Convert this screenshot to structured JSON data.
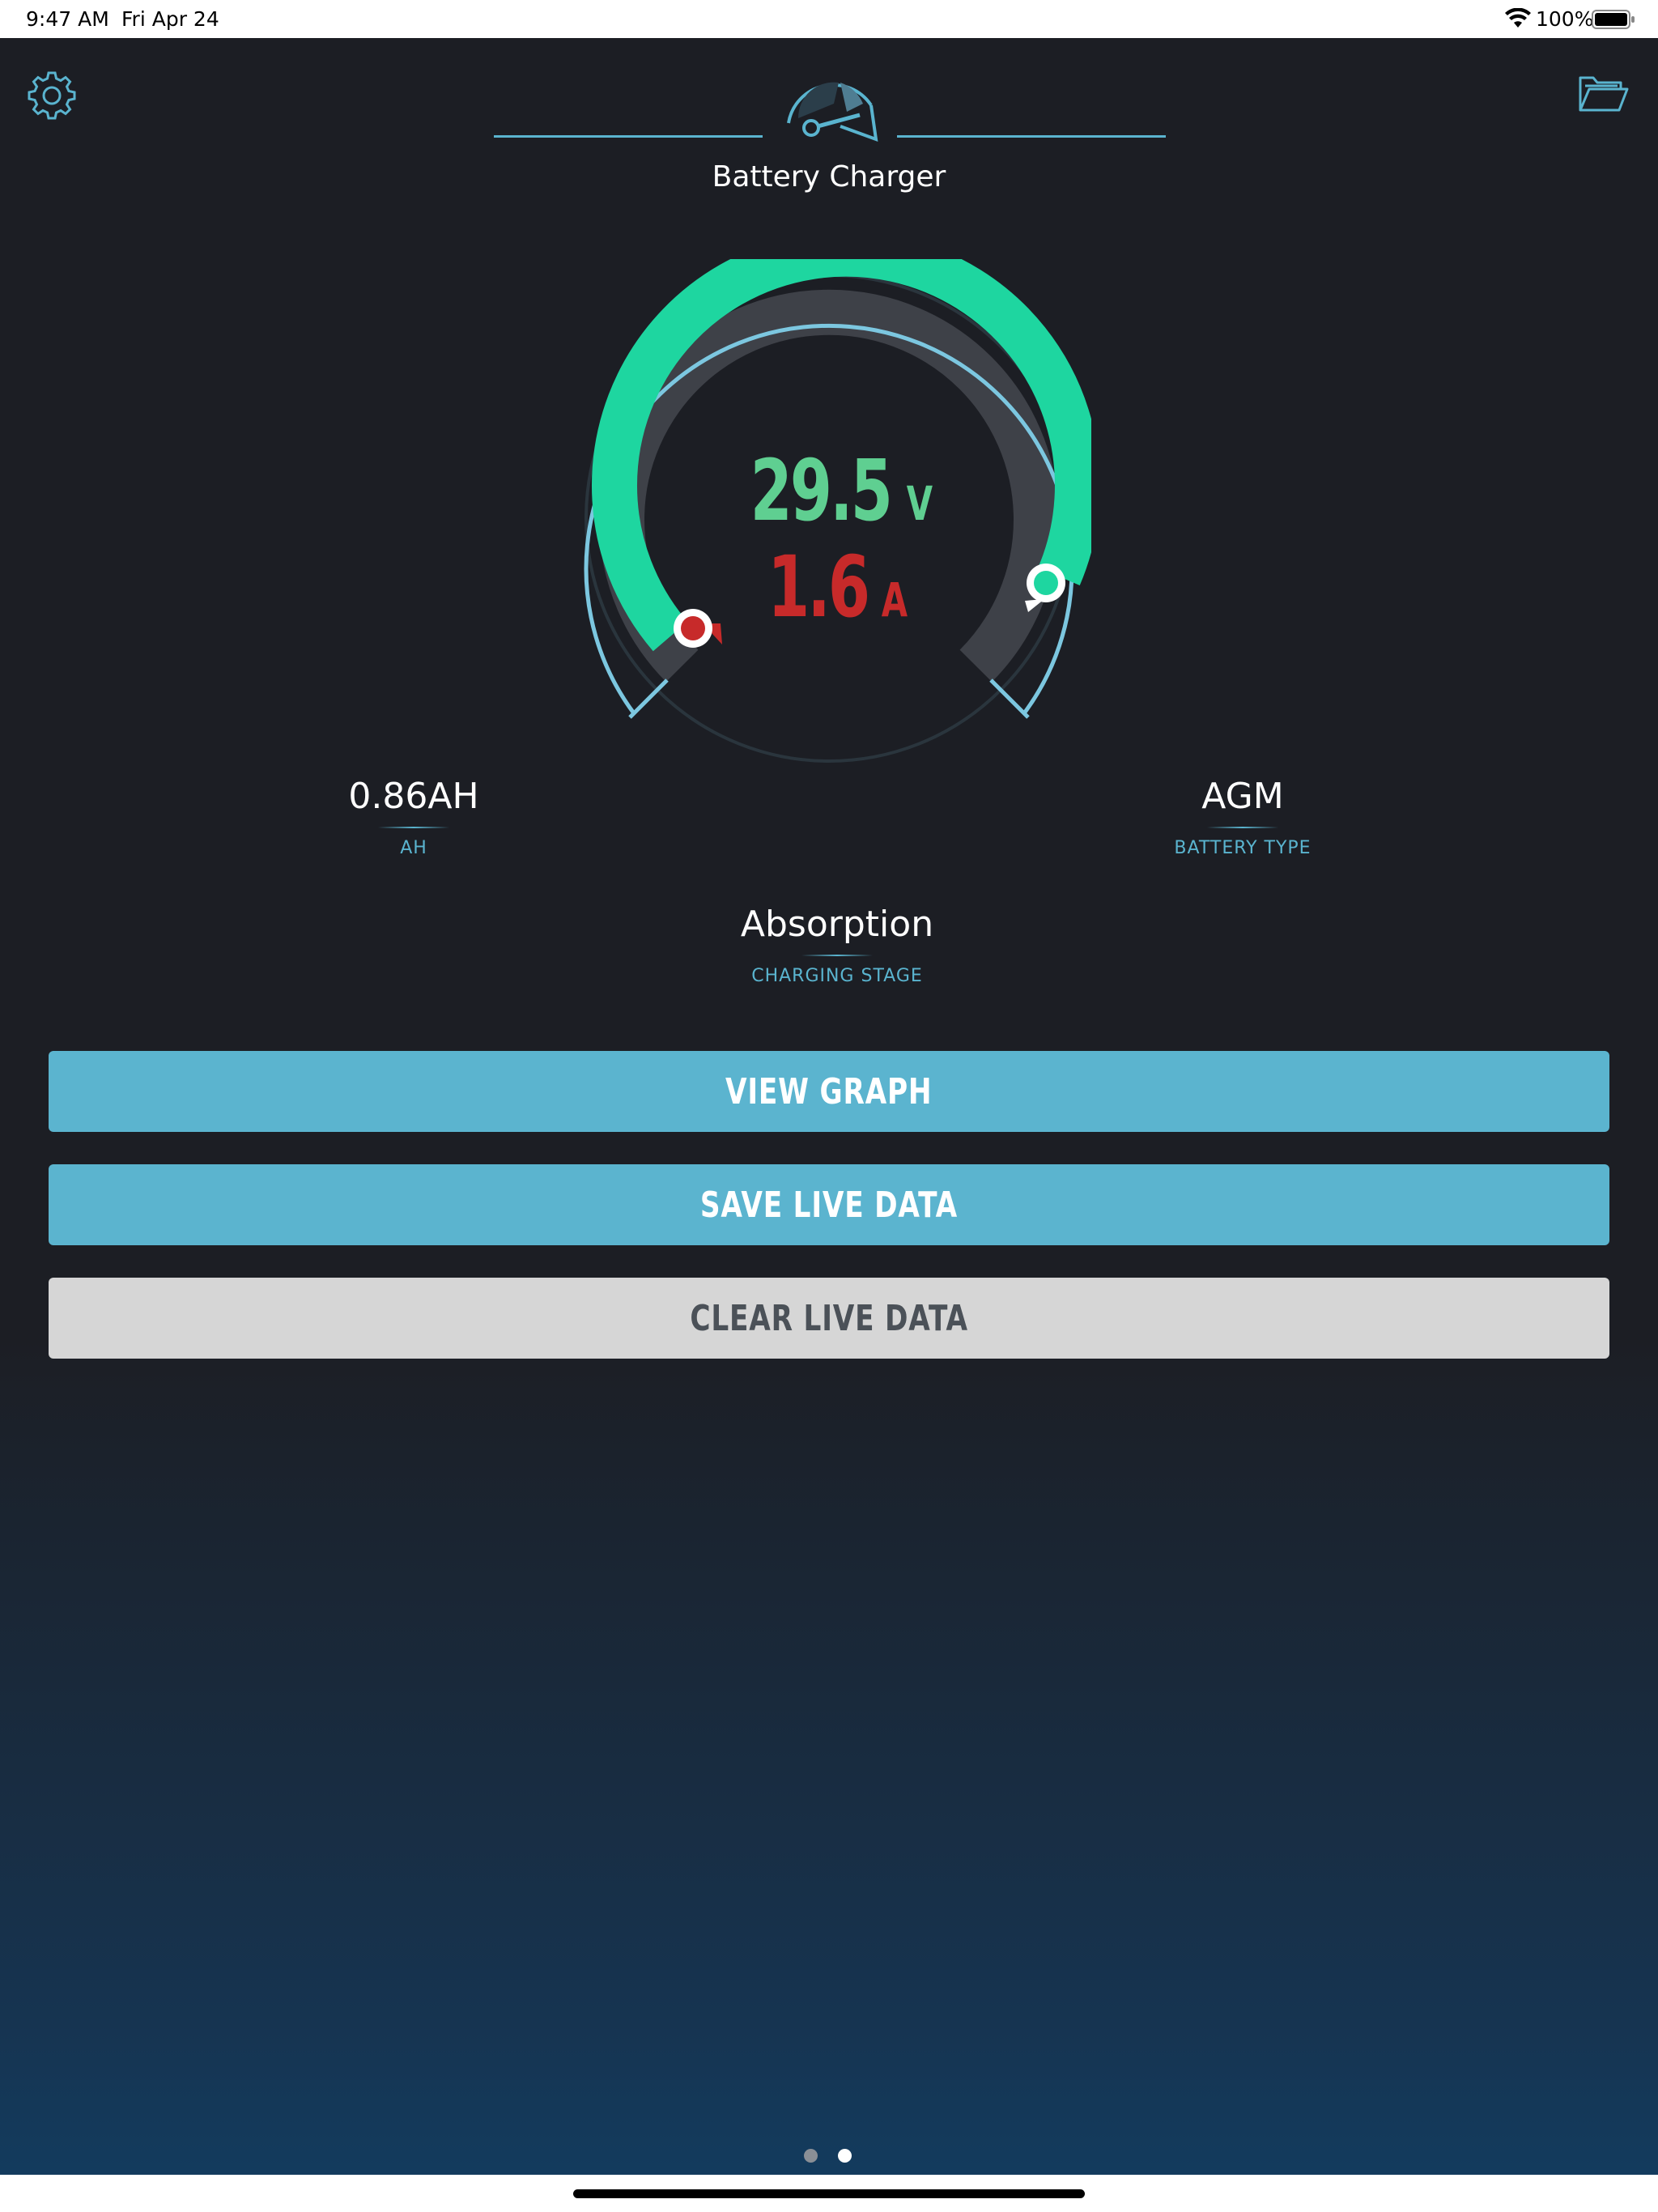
{
  "status_bar": {
    "time": "9:47 AM",
    "date": "Fri Apr 24",
    "battery_percent": "100%",
    "battery_level": 1.0
  },
  "header": {
    "title": "Battery Charger",
    "left_icon": "gear-icon",
    "center_icon": "speedometer-icon",
    "right_icon": "folder-icon"
  },
  "gauge": {
    "voltage_value": "29.5",
    "voltage_unit": "V",
    "current_value": "1.6",
    "current_unit": "A",
    "voltage_color": "#5fcf91",
    "current_color": "#c72a2a",
    "arc_color": "#1ed6a0",
    "track_color": "#3e4148"
  },
  "stats": {
    "ah": {
      "value": "0.86AH",
      "label": "AH"
    },
    "battery_type": {
      "value": "AGM",
      "label": "BATTERY TYPE"
    },
    "charging_stage": {
      "value": "Absorption",
      "label": "CHARGING STAGE"
    }
  },
  "buttons": {
    "view_graph": "VIEW GRAPH",
    "save_live_data": "SAVE LIVE DATA",
    "clear_live_data": "CLEAR LIVE DATA"
  },
  "pager": {
    "pages": 2,
    "current": 2
  },
  "colors": {
    "accent": "#5bb4cf",
    "background_top": "#1c1e24",
    "background_bottom": "#123d61"
  }
}
